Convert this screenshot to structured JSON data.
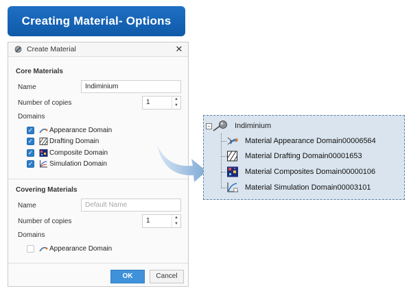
{
  "banner": {
    "title": "Creating Material- Options"
  },
  "dialog": {
    "title": "Create Material",
    "close_glyph": "✕",
    "core": {
      "heading": "Core Materials",
      "name_label": "Name",
      "name_value": "Indiminium",
      "copies_label": "Number of copies",
      "copies_value": "1",
      "domains_label": "Domains",
      "domains": [
        {
          "label": "Appearance Domain",
          "checked": true,
          "icon": "appearance-domain-icon"
        },
        {
          "label": "Drafting Domain",
          "checked": true,
          "icon": "drafting-domain-icon"
        },
        {
          "label": "Composite Domain",
          "checked": true,
          "icon": "composite-domain-icon"
        },
        {
          "label": "Simulation Domain",
          "checked": true,
          "icon": "simulation-domain-icon"
        }
      ]
    },
    "covering": {
      "heading": "Covering Materials",
      "name_label": "Name",
      "name_placeholder": "Default Name",
      "copies_label": "Number of copies",
      "copies_value": "1",
      "domains_label": "Domains",
      "domains": [
        {
          "label": "Appearance Domain",
          "checked": false,
          "icon": "appearance-domain-icon"
        }
      ]
    },
    "ok_label": "OK",
    "cancel_label": "Cancel"
  },
  "tree": {
    "root_label": "Indiminium",
    "items": [
      {
        "label": "Material Appearance Domain00006564",
        "icon": "appearance-domain-icon"
      },
      {
        "label": "Material Drafting Domain00001653",
        "icon": "drafting-domain-icon"
      },
      {
        "label": "Material Composites Domain00000106",
        "icon": "composite-domain-icon"
      },
      {
        "label": "Material Simulation Domain00003101",
        "icon": "simulation-domain-icon"
      }
    ]
  },
  "colors": {
    "banner": "#1565b8",
    "ok_button": "#3f92d9",
    "checkbox": "#2d7ec9",
    "tree_background": "#d9e4ee",
    "arrow": "#8fb6dc"
  }
}
